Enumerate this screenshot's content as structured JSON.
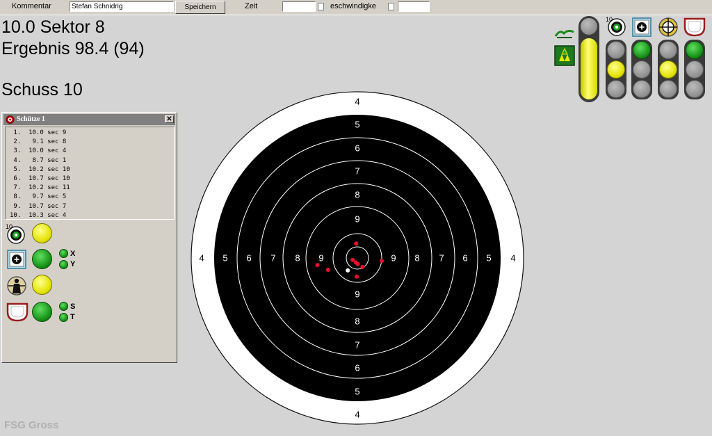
{
  "toolbar": {
    "kommentar_label": "Kommentar",
    "kommentar_value": "Stefan Schnidrig",
    "save_label": "Speichern",
    "zeit_label": "Zeit",
    "speed_label": "eschwindigke"
  },
  "summary": {
    "shot_line": "10.0 Sektor 8",
    "result_line": "Ergebnis 98.4 (94)",
    "shot_number": "Schuss 10"
  },
  "panel": {
    "title": "Schütze 1",
    "close_glyph": "✕",
    "shots": [
      " 1.  10.0 sec 9",
      " 2.   9.1 sec 8",
      " 3.  10.0 sec 4",
      " 4.   8.7 sec 1",
      " 5.  10.2 sec 10",
      " 6.  10.7 sec 10",
      " 7.  10.2 sec 11",
      " 8.   9.7 sec 5",
      " 9.  10.7 sec 7",
      "10.  10.3 sec 4"
    ],
    "indicators": {
      "ring10_badge": "10",
      "x_label": "X",
      "y_label": "Y",
      "s_label": "S",
      "t_label": "T"
    }
  },
  "target": {
    "ring_numbers": [
      "4",
      "5",
      "6",
      "7",
      "8",
      "9"
    ],
    "shots": [
      {
        "x": -0.4,
        "y": -4.5
      },
      {
        "x": 7.6,
        "y": 0.9
      },
      {
        "x": -1.5,
        "y": 0.6
      },
      {
        "x": -0.5,
        "y": 1.4
      },
      {
        "x": -12.5,
        "y": 2.2
      },
      {
        "x": -9.2,
        "y": 3.7
      },
      {
        "x": 1.6,
        "y": 2.8
      },
      {
        "x": 0.1,
        "y": 1.9
      },
      {
        "x": -0.2,
        "y": 5.8
      },
      {
        "x": -3.0,
        "y": 3.9,
        "current": true
      }
    ],
    "shot_color": "#e8102a",
    "current_shot_color": "#ffffff"
  },
  "status_icons": {
    "ring10_badge": "10"
  },
  "footer": {
    "brand": "FSG Gross"
  }
}
